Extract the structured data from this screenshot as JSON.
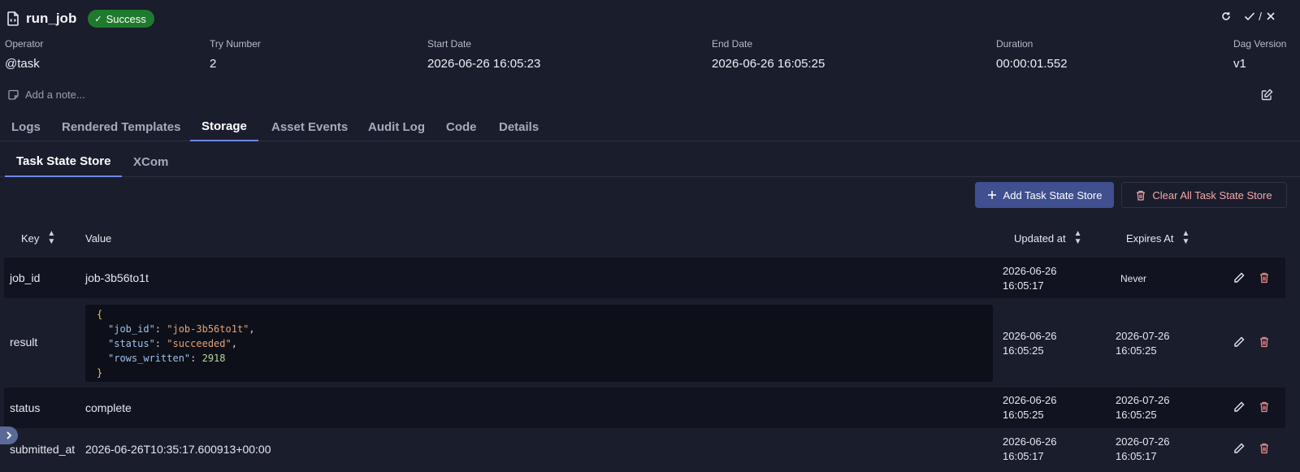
{
  "header": {
    "title": "run_job",
    "status": "Success",
    "actions": {
      "refresh_icon": "refresh-icon",
      "state_sep": "/"
    }
  },
  "meta": [
    {
      "label": "Operator",
      "value": "@task"
    },
    {
      "label": "Try Number",
      "value": "2"
    },
    {
      "label": "Start Date",
      "value": "2026-06-26 16:05:23"
    },
    {
      "label": "End Date",
      "value": "2026-06-26 16:05:25"
    },
    {
      "label": "Duration",
      "value": "00:00:01.552"
    },
    {
      "label": "Dag Version",
      "value": "v1"
    }
  ],
  "note": {
    "placeholder": "Add a note..."
  },
  "tabs": [
    {
      "label": "Logs",
      "active": false
    },
    {
      "label": "Rendered Templates",
      "active": false
    },
    {
      "label": "Storage",
      "active": true
    },
    {
      "label": "Asset Events",
      "active": false
    },
    {
      "label": "Audit Log",
      "active": false
    },
    {
      "label": "Code",
      "active": false
    },
    {
      "label": "Details",
      "active": false
    }
  ],
  "subtabs": [
    {
      "label": "Task State Store",
      "active": true
    },
    {
      "label": "XCom",
      "active": false
    }
  ],
  "buttons": {
    "add": "Add Task State Store",
    "clear": "Clear All Task State Store"
  },
  "table": {
    "headers": {
      "key": "Key",
      "value": "Value",
      "updated": "Updated at",
      "expires": "Expires At"
    },
    "rows": [
      {
        "key": "job_id",
        "value": "job-3b56to1t",
        "updated_date": "2026-06-26",
        "updated_time": "16:05:17",
        "expires": "Never"
      },
      {
        "key": "result",
        "json": {
          "open": "{",
          "close": "}",
          "lines": [
            {
              "k": "\"job_id\"",
              "v": "\"job-3b56to1t\"",
              "type": "s",
              "comma": ","
            },
            {
              "k": "\"status\"",
              "v": "\"succeeded\"",
              "type": "s",
              "comma": ","
            },
            {
              "k": "\"rows_written\"",
              "v": "2918",
              "type": "n",
              "comma": ""
            }
          ]
        },
        "updated_date": "2026-06-26",
        "updated_time": "16:05:25",
        "expires_date": "2026-07-26",
        "expires_time": "16:05:25"
      },
      {
        "key": "status",
        "value": "complete",
        "updated_date": "2026-06-26",
        "updated_time": "16:05:25",
        "expires_date": "2026-07-26",
        "expires_time": "16:05:25"
      },
      {
        "key": "submitted_at",
        "value": "2026-06-26T10:35:17.600913+00:00",
        "updated_date": "2026-06-26",
        "updated_time": "16:05:17",
        "expires_date": "2026-07-26",
        "expires_time": "16:05:17"
      }
    ]
  },
  "colors": {
    "accent": "#6e87e8",
    "success": "#1f7a2e",
    "danger": "#f08a8a",
    "bg": "#1a1d2c"
  }
}
